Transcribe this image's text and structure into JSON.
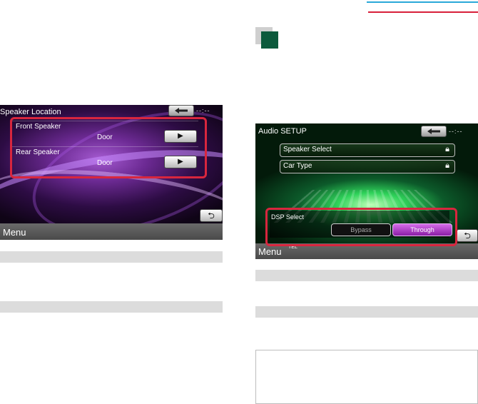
{
  "left_screen": {
    "title": "Speaker Location",
    "clock": "--:--",
    "sections": [
      {
        "label": "Front Speaker",
        "value": "Door",
        "button": "▶"
      },
      {
        "label": "Rear Speaker",
        "value": "Door",
        "button": "▶"
      }
    ],
    "menu_label": "Menu",
    "return_glyph": "⮌"
  },
  "right_screen": {
    "title": "Audio SETUP",
    "clock": "--:--",
    "items": [
      {
        "label": "Speaker Select",
        "icon": "lock-icon"
      },
      {
        "label": "Car Type",
        "icon": "lock-icon"
      }
    ],
    "dsp": {
      "label": "DSP Select",
      "options": [
        "Bypass",
        "Through"
      ],
      "selected": "Through"
    },
    "menu_label": "Menu",
    "tel_label": "TEL",
    "return_glyph": "⮌"
  },
  "colors": {
    "highlight_red": "#d8263e",
    "rule_blue": "#2aa8d8",
    "rule_red": "#d81f3a",
    "marker_green": "#0c5a3c",
    "through_purple": "#b23fcc"
  }
}
